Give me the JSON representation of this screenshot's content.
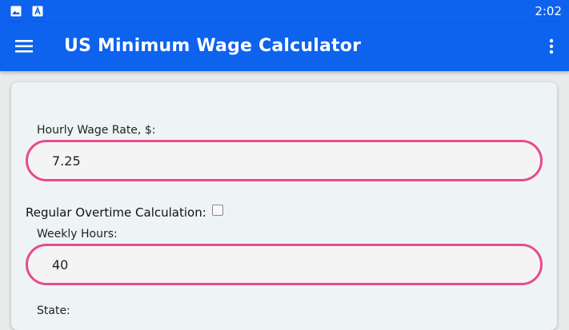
{
  "status_bar": {
    "icons": [
      "image-icon",
      "a-letter-icon"
    ],
    "time": "2:02"
  },
  "app_bar": {
    "title": "US Minimum Wage Calculator"
  },
  "form": {
    "hourly_wage": {
      "label": "Hourly Wage Rate, $:",
      "value": "7.25"
    },
    "overtime": {
      "label": "Regular Overtime Calculation:",
      "checked": false
    },
    "weekly_hours": {
      "label": "Weekly Hours:",
      "value": "40"
    },
    "state": {
      "label": "State:"
    }
  },
  "colors": {
    "app_bar": "#0d62ee",
    "input_border": "#e94a8e",
    "card_bg": "#eef4f5"
  }
}
